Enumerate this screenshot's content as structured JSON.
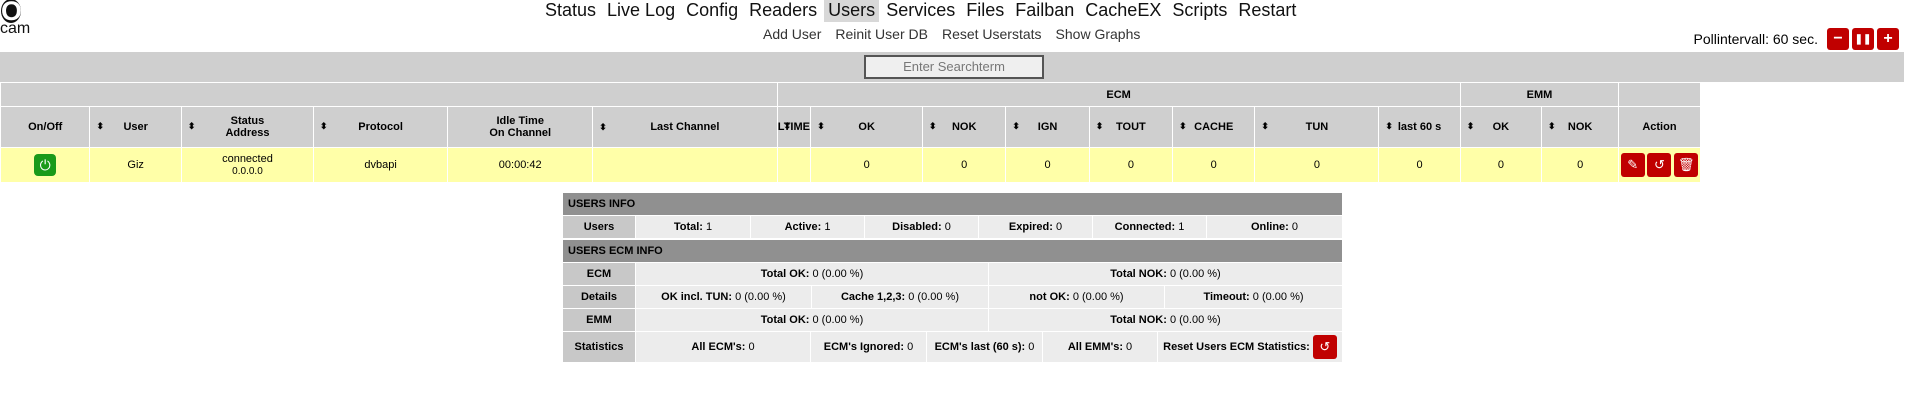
{
  "logo": {
    "text_top": "OS",
    "text_bottom": "cam"
  },
  "nav": [
    "Status",
    "Live Log",
    "Config",
    "Readers",
    "Users",
    "Services",
    "Files",
    "Failban",
    "CacheEX",
    "Scripts",
    "Restart"
  ],
  "nav_active": "Users",
  "subnav": [
    "Add User",
    "Reinit User DB",
    "Reset Userstats",
    "Show Graphs"
  ],
  "poll": {
    "label": "Pollintervall: 60 sec.",
    "minus": "−",
    "pause": "❚❚",
    "plus": "+"
  },
  "search": {
    "placeholder": "Enter Searchterm"
  },
  "table": {
    "group_ecm": "ECM",
    "group_emm": "EMM",
    "headers": {
      "onoff": "On/Off",
      "user": "User",
      "status_line1": "Status",
      "status_line2": "Address",
      "protocol": "Protocol",
      "idle_line1": "Idle Time",
      "idle_line2": "On Channel",
      "last_channel": "Last Channel",
      "ltime": "LTIME",
      "ok": "OK",
      "nok": "NOK",
      "ign": "IGN",
      "tout": "TOUT",
      "cache": "CACHE",
      "tun": "TUN",
      "last60": "last 60 s",
      "emm_ok": "OK",
      "emm_nok": "NOK",
      "action": "Action"
    },
    "row": {
      "user": "Giz",
      "status": "connected",
      "address": "0.0.0.0",
      "protocol": "dvbapi",
      "idle": "00:00:42",
      "last_channel": "",
      "ltime": "",
      "ok": "0",
      "nok": "0",
      "ign": "0",
      "tout": "0",
      "cache": "0",
      "tun": "0",
      "last60": "0",
      "emm_ok": "0",
      "emm_nok": "0"
    },
    "sort_icon": "⬍"
  },
  "users_info": {
    "title": "USERS INFO",
    "label": "Users",
    "total_l": "Total:",
    "total_v": "1",
    "active_l": "Active:",
    "active_v": "1",
    "disabled_l": "Disabled:",
    "disabled_v": "0",
    "expired_l": "Expired:",
    "expired_v": "0",
    "connected_l": "Connected:",
    "connected_v": "1",
    "online_l": "Online:",
    "online_v": "0"
  },
  "ecm_info": {
    "title": "USERS ECM INFO",
    "ecm_label": "ECM",
    "ecm_ok_l": "Total OK:",
    "ecm_ok_v": "0 (0.00 %)",
    "ecm_nok_l": "Total NOK:",
    "ecm_nok_v": "0 (0.00 %)",
    "details_label": "Details",
    "okinc_l": "OK incl. TUN:",
    "okinc_v": "0 (0.00 %)",
    "cache_l": "Cache 1,2,3:",
    "cache_v": "0 (0.00 %)",
    "notok_l": "not OK:",
    "notok_v": "0 (0.00 %)",
    "timeout_l": "Timeout:",
    "timeout_v": "0 (0.00 %)",
    "emm_label": "EMM",
    "emm_ok_l": "Total OK:",
    "emm_ok_v": "0 (0.00 %)",
    "emm_nok_l": "Total NOK:",
    "emm_nok_v": "0 (0.00 %)",
    "stats_label": "Statistics",
    "allecm_l": "All ECM's:",
    "allecm_v": "0",
    "ignored_l": "ECM's Ignored:",
    "ignored_v": "0",
    "last60_l": "ECM's last (60 s):",
    "last60_v": "0",
    "allemm_l": "All EMM's:",
    "allemm_v": "0",
    "reset_l": "Reset Users ECM Statistics:"
  },
  "colors": {
    "accent": "#c00000",
    "on": "#1a9a1a",
    "row_bg": "#ffffa8",
    "header_bg": "#cfcfcf"
  }
}
